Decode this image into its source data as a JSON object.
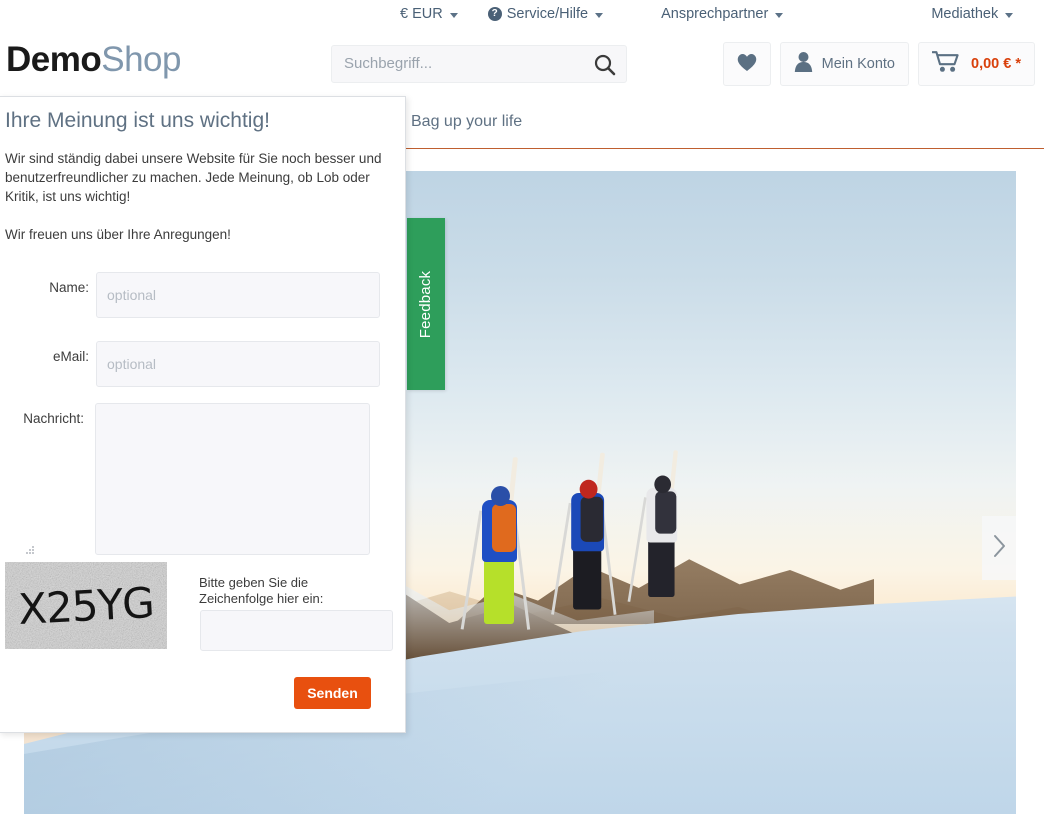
{
  "topnav": {
    "items": [
      {
        "label": "€ EUR",
        "icon": null,
        "caret": true
      },
      {
        "label": "Service/Hilfe",
        "icon": "help-circle-icon",
        "caret": true
      },
      {
        "label": "Ansprechpartner",
        "icon": null,
        "caret": true
      },
      {
        "label": "Mediathek",
        "icon": null,
        "caret": true
      }
    ]
  },
  "header": {
    "logo_bold": "Demo",
    "logo_light": "Shop",
    "search_placeholder": "Suchbegriff...",
    "search_value": "",
    "account_label": "Mein Konto",
    "cart_amount": "0,00 € *",
    "wishlist_icon": "heart-icon",
    "account_icon": "user-icon",
    "cart_icon": "shopping-cart-icon",
    "search_icon": "search-icon"
  },
  "nav": {
    "tagline": "Bag up your life"
  },
  "hero": {
    "next_arrow": "chevron-right-icon"
  },
  "feedback_tab": {
    "label": "Feedback"
  },
  "feedback_form": {
    "title": "Ihre Meinung ist uns wichtig!",
    "paragraph1": "Wir sind ständig dabei unsere Website für Sie noch besser und benutzerfreundlicher zu machen. Jede Meinung, ob Lob oder Kritik, ist uns wichtig!",
    "paragraph2": "Wir freuen uns über Ihre Anregungen!",
    "name_label": "Name:",
    "name_placeholder": "optional",
    "name_value": "",
    "email_label": "eMail:",
    "email_placeholder": "optional",
    "email_value": "",
    "message_label": "Nachricht:",
    "message_value": "",
    "captcha_text": "X25YG",
    "captcha_prompt": "Bitte geben Sie die Zeichenfolge hier ein:",
    "captcha_value": "",
    "submit_label": "Senden"
  },
  "colors": {
    "accent_orange": "#e8500f",
    "feedback_green": "#2e9e5b",
    "nav_border": "#bf5f2f",
    "text_muted": "#5f7183",
    "cart_price": "#d9400b"
  }
}
